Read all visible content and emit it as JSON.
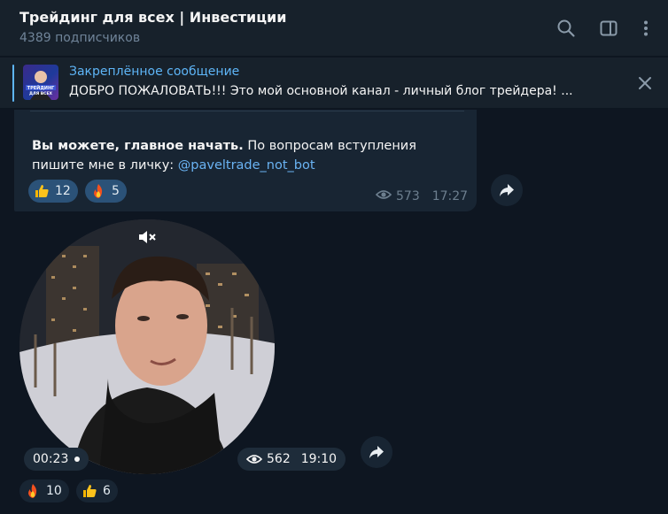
{
  "header": {
    "title": "Трейдинг для всех | Инвестиции",
    "subtitle": "4389 подписчиков",
    "icons": [
      "search-icon",
      "sidebar-toggle-icon",
      "more-vertical-icon"
    ]
  },
  "pinned": {
    "label": "Закреплённое сообщение",
    "text": "ДОБРО ПОЖАЛОВАТЬ!!! Это мой основной канал - личный блог трейдера! ...",
    "thumb_text": "ТРЕЙДИНГ ДЛЯ ВСЕХ"
  },
  "message1": {
    "bold": "Вы можете, главное начать.",
    "text": " По вопросам вступления пишите мне в личку: ",
    "link": "@paveltrade_not_bot",
    "reactions": [
      {
        "emoji": "thumbs-up",
        "count": "12"
      },
      {
        "emoji": "fire",
        "count": "5"
      }
    ],
    "views": "573",
    "time": "17:27"
  },
  "message2": {
    "duration": "00:23",
    "views": "562",
    "time": "19:10",
    "reactions": [
      {
        "emoji": "fire",
        "count": "10"
      },
      {
        "emoji": "thumbs-up",
        "count": "6"
      }
    ]
  },
  "colors": {
    "background": "#0e1621",
    "header": "#17212b",
    "bubble": "#182533",
    "accent": "#5eb5f7",
    "link": "#6ab3f3",
    "reaction": "#2b5278"
  }
}
